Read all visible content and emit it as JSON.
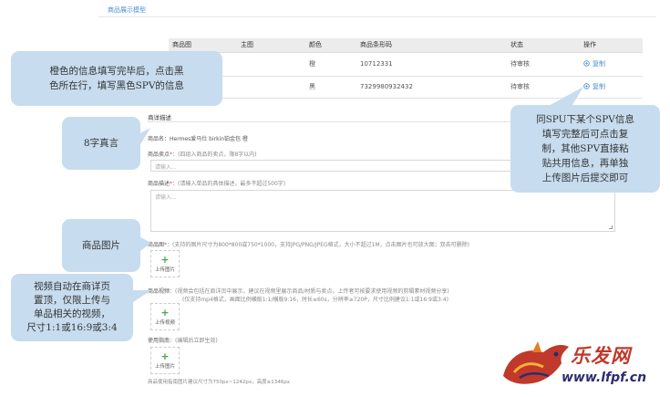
{
  "header": {
    "tab_link": "商品展示模型"
  },
  "sku_table": {
    "columns": [
      "商品图",
      "主图",
      "颜色",
      "商品条形码",
      "状态",
      "操作"
    ],
    "rows": [
      {
        "color": "橙",
        "barcode": "10712331",
        "status": "待审核",
        "action": "复制"
      },
      {
        "color": "黑",
        "barcode": "7329980932432",
        "status": "待审核",
        "action": "复制"
      }
    ]
  },
  "form": {
    "section_title": "商详描述",
    "product_name_line": "商品名：Hermes爱马仕 birkin铂金包 橙",
    "sell_point_label": "商品卖点",
    "sell_point_hint": "：(四组入商品的卖点，限8字以内)",
    "sell_point_placeholder": "请输入...",
    "desc_label": "商品描述",
    "desc_hint": "：(请输入单品的具体描述，最多不超过500字)",
    "desc_placeholder": "请输入...",
    "image_label": "商品图",
    "image_hint": "：(支持的图片尺寸为800*800或750*1000，支持JPG/PNG/JPEG格式，大小不超过1M，点击图片也可放大图；双击可删除)",
    "upload_image_label": "上传图片",
    "video_label": "商品视频",
    "video_hint": "：(视频会包括在商详页中展示，建议在视频里展示商品/材质与卖点，上传者可按要求使用视频的剪辑素材视频分享)",
    "video_hint2": "(仅支持mp4格式，画面比例横版1:1/横版9:16，时长≤60s，分辨率≥720P，尺寸比例建议1:1或16:9或3:4)",
    "upload_video_label": "上传视频",
    "usage_label": "使用指南",
    "usage_hint": "：(编辑后立即生效)",
    "upload_usage_label": "上传图片",
    "usage_footer": "商品使用指南图片建议尺寸为750px~1242px，高度≤1346px"
  },
  "callouts": {
    "orange_info": [
      "橙色的信息填写完毕后，点击黑",
      "色所在行，填写黑色SPV的信息"
    ],
    "eight_chars": "8字真言",
    "product_image": "商品图片",
    "video": [
      "视频自动在商详页",
      "置顶，仅限上传与",
      "单品相关的视频，",
      "尺寸1:1或16:9或3:4"
    ],
    "spu_copy": [
      "同SPU下某个SPV信息",
      "填写完整后可点击复",
      "制，其他SPV直接粘",
      "贴共用信息，再单独",
      "上传图片后提交即可"
    ]
  },
  "watermark": {
    "brand_cn": "乐发网",
    "url": "www.lfpf.cn"
  },
  "colors": {
    "link": "#4a8fd4",
    "callout_bg": "#c7dcee",
    "required": "#e24d4d",
    "watermark_red": "#c0392b",
    "watermark_navy": "#2c2c6e"
  }
}
